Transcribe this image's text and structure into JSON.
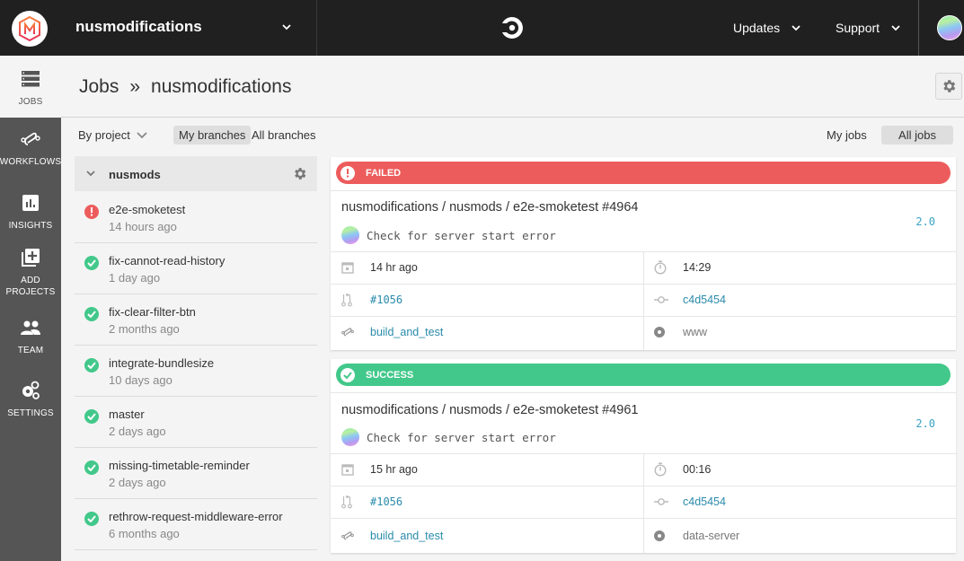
{
  "topbar": {
    "org_name": "nusmodifications",
    "menus": [
      {
        "label": "Updates"
      },
      {
        "label": "Support"
      }
    ]
  },
  "sidebar": {
    "items": [
      {
        "label": "JOBS",
        "icon": "jobs-icon",
        "active": true
      },
      {
        "label": "WORKFLOWS",
        "icon": "workflows-icon"
      },
      {
        "label": "INSIGHTS",
        "icon": "insights-icon"
      },
      {
        "label": "ADD PROJECTS",
        "line1": "ADD",
        "line2": "PROJECTS",
        "icon": "add-projects-icon"
      },
      {
        "label": "TEAM",
        "icon": "team-icon"
      },
      {
        "label": "SETTINGS",
        "icon": "settings-icon"
      }
    ]
  },
  "header": {
    "crumb_root": "Jobs",
    "crumb_sep": "»",
    "crumb_current": "nusmodifications"
  },
  "filters": {
    "group_by": "By project",
    "my_branches": "My branches",
    "all_branches": "All branches",
    "my_jobs": "My jobs",
    "all_jobs": "All jobs"
  },
  "project": {
    "name": "nusmods",
    "branches": [
      {
        "name": "e2e-smoketest",
        "time": "14 hours ago",
        "status": "failed"
      },
      {
        "name": "fix-cannot-read-history",
        "time": "1 day ago",
        "status": "success"
      },
      {
        "name": "fix-clear-filter-btn",
        "time": "2 months ago",
        "status": "success"
      },
      {
        "name": "integrate-bundlesize",
        "time": "10 days ago",
        "status": "success"
      },
      {
        "name": "master",
        "time": "2 days ago",
        "status": "success"
      },
      {
        "name": "missing-timetable-reminder",
        "time": "2 days ago",
        "status": "success"
      },
      {
        "name": "rethrow-request-middleware-error",
        "time": "6 months ago",
        "status": "success"
      }
    ]
  },
  "jobs": [
    {
      "status": "FAILED",
      "status_color": "#ed5c5c",
      "title": "nusmodifications / nusmods / e2e-smoketest #4964",
      "commit_message": "Check for server start error",
      "version": "2.0",
      "started": "14 hr ago",
      "duration": "14:29",
      "pr": "#1056",
      "commit": "c4d5454",
      "workflow": "build_and_test",
      "job_name": "www"
    },
    {
      "status": "SUCCESS",
      "status_color": "#42c88a",
      "title": "nusmodifications / nusmods / e2e-smoketest #4961",
      "commit_message": "Check for server start error",
      "version": "2.0",
      "started": "15 hr ago",
      "duration": "00:16",
      "pr": "#1056",
      "commit": "c4d5454",
      "workflow": "build_and_test",
      "job_name": "data-server"
    }
  ],
  "colors": {
    "failed": "#ed5c5c",
    "success": "#42c88a",
    "link": "#2a8bab"
  }
}
